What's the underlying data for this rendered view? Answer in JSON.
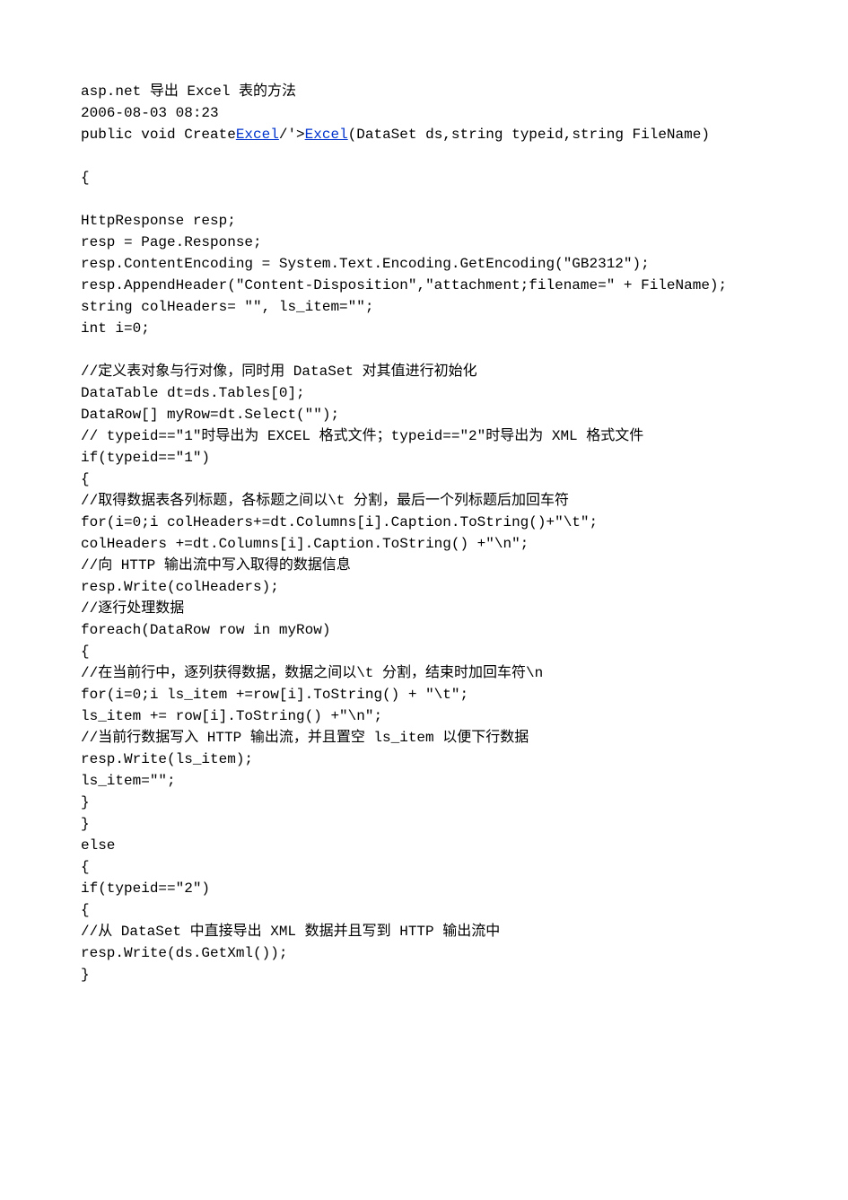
{
  "doc": {
    "title_line": "asp.net 导出 Excel 表的方法",
    "timestamp": "2006-08-03 08:23",
    "sig_pre": "public void Create",
    "link_excel_1": "Excel",
    "sig_mid": "/'>",
    "link_excel_2": "Excel",
    "sig_post": "(DataSet ds,string typeid,string FileName)",
    "blank": "",
    "brace_open": "{",
    "l_resp_decl": "HttpResponse resp;",
    "l_resp_assign": "resp = Page.Response;",
    "l_encoding": "resp.ContentEncoding = System.Text.Encoding.GetEncoding(\"GB2312\");",
    "l_header": "resp.AppendHeader(\"Content-Disposition\",\"attachment;filename=\" + FileName);",
    "l_colheaders_decl": "string colHeaders= \"\", ls_item=\"\";",
    "l_int_i": "int i=0;",
    "c_define": "//定义表对象与行对像，同时用 DataSet 对其值进行初始化",
    "l_dt": "DataTable dt=ds.Tables[0];",
    "l_myrow": "DataRow[] myRow=dt.Select(\"\");",
    "c_typeid": "// typeid==\"1\"时导出为 EXCEL 格式文件；typeid==\"2\"时导出为 XML 格式文件",
    "l_if1": "if(typeid==\"1\")",
    "brace_open2": "{",
    "c_colheaders": "//取得数据表各列标题，各标题之间以\\t 分割，最后一个列标题后加回车符",
    "l_for1": "for(i=0;i colHeaders+=dt.Columns[i].Caption.ToString()+\"\\t\";",
    "l_colh2": "colHeaders +=dt.Columns[i].Caption.ToString() +\"\\n\";",
    "c_write1": "//向 HTTP 输出流中写入取得的数据信息",
    "l_write1": "resp.Write(colHeaders);",
    "c_rows": "//逐行处理数据",
    "l_foreach": "foreach(DataRow row in myRow)",
    "brace_open3": "{",
    "c_row": "//在当前行中，逐列获得数据，数据之间以\\t 分割，结束时加回车符\\n",
    "l_for2": "for(i=0;i ls_item +=row[i].ToString() + \"\\t\";",
    "l_lsitem": "ls_item += row[i].ToString() +\"\\n\";",
    "c_write2": "//当前行数据写入 HTTP 输出流，并且置空 ls_item 以便下行数据",
    "l_write2": "resp.Write(ls_item);",
    "l_reset": "ls_item=\"\";",
    "brace_close1": "}",
    "brace_close2": "}",
    "l_else": "else",
    "brace_open4": "{",
    "l_if2": "if(typeid==\"2\")",
    "brace_open5": "{",
    "c_xml": "//从 DataSet 中直接导出 XML 数据并且写到 HTTP 输出流中",
    "l_getxml": "resp.Write(ds.GetXml());",
    "brace_close3": "}"
  }
}
